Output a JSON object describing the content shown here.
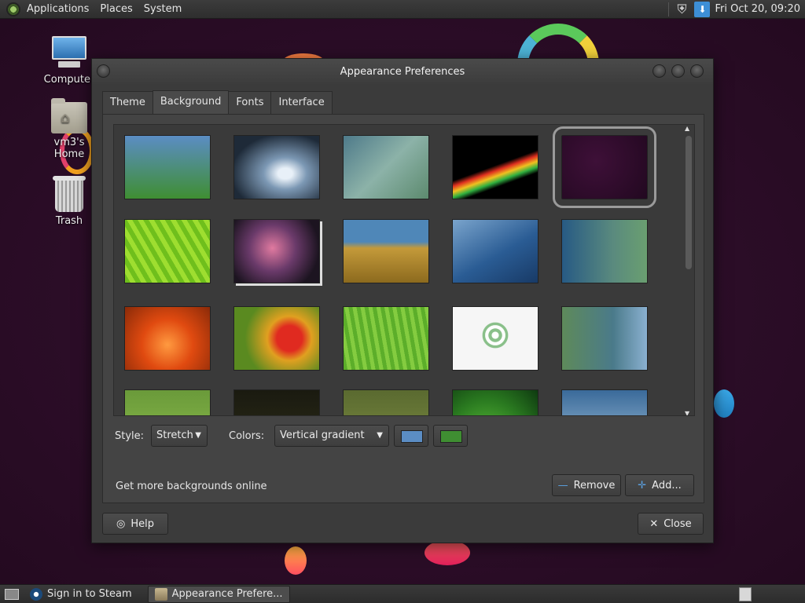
{
  "top_panel": {
    "menus": [
      "Applications",
      "Places",
      "System"
    ],
    "clock": "Fri Oct 20, 09:20"
  },
  "desktop": {
    "icons": [
      {
        "label": "Computer"
      },
      {
        "label": "vm3's Home"
      },
      {
        "label": "Trash"
      }
    ]
  },
  "dialog": {
    "title": "Appearance Preferences",
    "tabs": [
      "Theme",
      "Background",
      "Fonts",
      "Interface"
    ],
    "active_tab": "Background",
    "style_label": "Style:",
    "style_value": "Stretch",
    "colors_label": "Colors:",
    "colors_value": "Vertical gradient",
    "primary_color": "#5b8dc4",
    "secondary_color": "#3f8e32",
    "more_link": "Get more backgrounds online",
    "remove_label": "Remove",
    "add_label": "Add...",
    "help_label": "Help",
    "close_label": "Close"
  },
  "bottom_panel": {
    "tasks": [
      {
        "label": "Sign in to Steam"
      },
      {
        "label": "Appearance Prefere..."
      }
    ]
  },
  "colors": {
    "desktop_bg": "#2b0d27",
    "dialog_bg": "#3b3b3b"
  }
}
